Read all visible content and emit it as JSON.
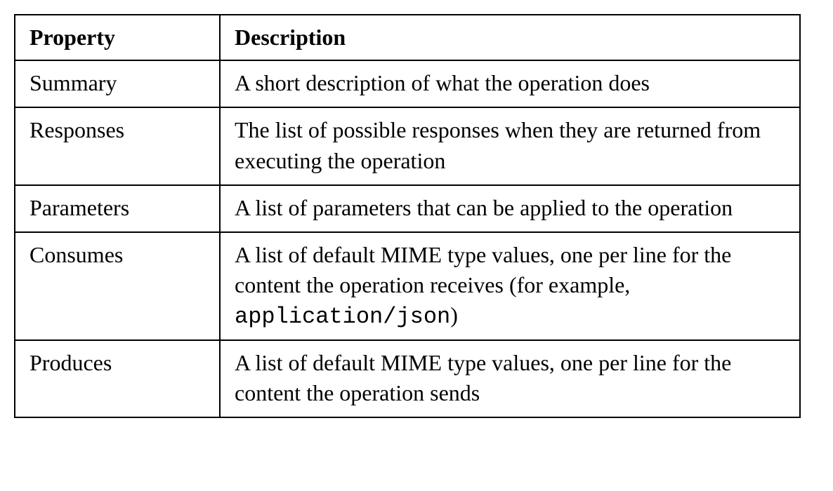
{
  "table": {
    "headers": {
      "property": "Property",
      "description": "Description"
    },
    "rows": [
      {
        "property": "Summary",
        "description_pre": "A short description of what the operation does",
        "description_code": "",
        "description_post": ""
      },
      {
        "property": "Responses",
        "description_pre": "The list of possible responses when they are returned from executing the operation",
        "description_code": "",
        "description_post": ""
      },
      {
        "property": "Parameters",
        "description_pre": "A list of parameters that can be applied to the operation",
        "description_code": "",
        "description_post": ""
      },
      {
        "property": "Consumes",
        "description_pre": "A list of default MIME type values, one per line for the content the operation receives (for example, ",
        "description_code": "application/json",
        "description_post": ")"
      },
      {
        "property": "Produces",
        "description_pre": "A list of default MIME type values, one per line for the content the operation sends",
        "description_code": "",
        "description_post": ""
      }
    ]
  }
}
